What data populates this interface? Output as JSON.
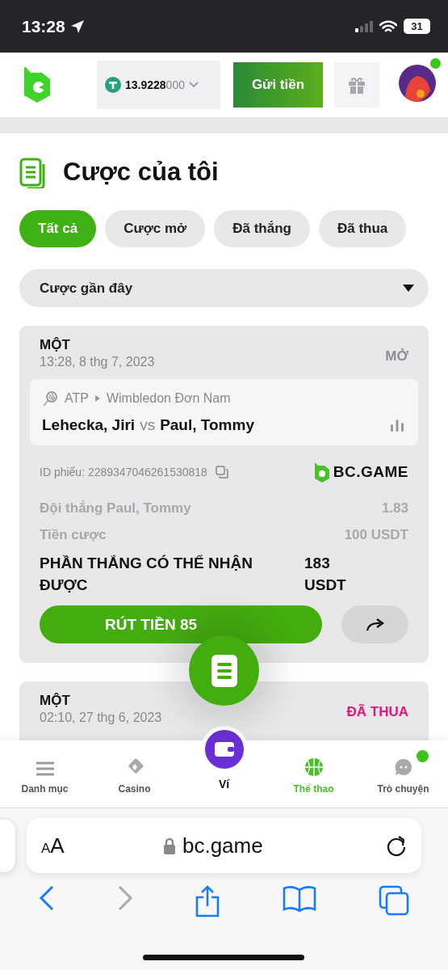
{
  "status_bar": {
    "time": "13:28",
    "battery": "31"
  },
  "header": {
    "balance": "13.9228",
    "balance_tail": "000",
    "deposit_button": "Gửi tiền",
    "avatar_notification": true
  },
  "page_title": "Cược của tôi",
  "filters": [
    {
      "label": "Tất cả",
      "selected": true
    },
    {
      "label": "Cược mở",
      "selected": false
    },
    {
      "label": "Đã thắng",
      "selected": false
    },
    {
      "label": "Đã thua",
      "selected": false
    }
  ],
  "sort_dropdown": "Cược gần đây",
  "bets": [
    {
      "type": "MỘT",
      "time": "13:28, 8 thg 7, 2023",
      "status": "MỞ",
      "color": "#8b8f96",
      "event": {
        "league": "ATP",
        "tournament": "Wimbledon Đơn Nam",
        "home": "Lehecka, Jiri",
        "vs": "vs",
        "away": "Paul, Tommy"
      },
      "ticket_id": "ID phiếu: 2289347046261530818",
      "brand": "BC.GAME",
      "rows": [
        {
          "label": "Đội thắng Paul, Tommy",
          "value": "1.83"
        },
        {
          "label": "Tiền cược",
          "value": "100 USDT"
        }
      ],
      "payout_label": "PHẦN THẮNG CÓ THỂ NHẬN ĐƯỢC",
      "payout": "183 USDT",
      "cashout_button": "RÚT TIỀN 85"
    },
    {
      "type": "MỘT",
      "time": "02:10, 27 thg 6, 2023",
      "status": "ĐÃ THUA",
      "color": "#e8157c"
    }
  ],
  "bottom_nav": [
    {
      "label": "Danh mục",
      "kind": "menu",
      "selected": false,
      "notification": false
    },
    {
      "label": "Casino",
      "kind": "casino",
      "selected": false,
      "notification": false
    },
    {
      "label": "Ví",
      "kind": "wallet",
      "selected": false,
      "notification": false
    },
    {
      "label": "Thể thao",
      "kind": "sports",
      "selected": true,
      "notification": false
    },
    {
      "label": "Trò chuyện",
      "kind": "chat",
      "selected": false,
      "notification": true
    }
  ],
  "browser": {
    "text_size_button": "AA",
    "url": "bc.game"
  }
}
